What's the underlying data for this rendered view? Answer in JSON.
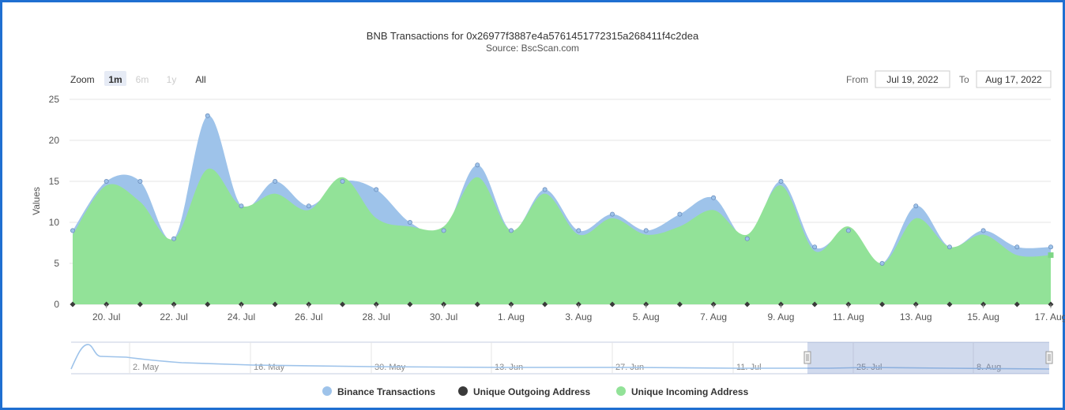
{
  "chart_data": {
    "type": "area",
    "title": "BNB Transactions for 0x26977f3887e4a5761451772315a268411f4c2dea",
    "subtitle": "Source: BscScan.com",
    "ylabel": "Values",
    "ylim": [
      0,
      25
    ],
    "yticks": [
      "0",
      "5",
      "10",
      "15",
      "20",
      "25"
    ],
    "grid": true,
    "legend_position": "bottom",
    "x": [
      "2022-07-19",
      "2022-07-20",
      "2022-07-21",
      "2022-07-22",
      "2022-07-23",
      "2022-07-24",
      "2022-07-25",
      "2022-07-26",
      "2022-07-27",
      "2022-07-28",
      "2022-07-29",
      "2022-07-30",
      "2022-07-31",
      "2022-08-01",
      "2022-08-02",
      "2022-08-03",
      "2022-08-04",
      "2022-08-05",
      "2022-08-06",
      "2022-08-07",
      "2022-08-08",
      "2022-08-09",
      "2022-08-10",
      "2022-08-11",
      "2022-08-12",
      "2022-08-13",
      "2022-08-14",
      "2022-08-15",
      "2022-08-16",
      "2022-08-17"
    ],
    "xticks": [
      "20. Jul",
      "22. Jul",
      "24. Jul",
      "26. Jul",
      "28. Jul",
      "30. Jul",
      "1. Aug",
      "3. Aug",
      "5. Aug",
      "7. Aug",
      "9. Aug",
      "11. Aug",
      "13. Aug",
      "15. Aug",
      "17. Aug"
    ],
    "series": [
      {
        "name": "Binance Transactions",
        "color": "#9ec3ea",
        "values": [
          9,
          15,
          15,
          8,
          23,
          12,
          15,
          12,
          15,
          14,
          10,
          9,
          17,
          9,
          14,
          9,
          11,
          9,
          11,
          13,
          8,
          15,
          7,
          9,
          5,
          12,
          7,
          9,
          7,
          7
        ]
      },
      {
        "name": "Unique Outgoing Address",
        "color": "#3a3a3a",
        "values": [
          0,
          0,
          0,
          0,
          0,
          0,
          0,
          0,
          0,
          0,
          0,
          0,
          0,
          0,
          0,
          0,
          0,
          0,
          0,
          0,
          0,
          0,
          0,
          0,
          0,
          0,
          0,
          0,
          0,
          0
        ]
      },
      {
        "name": "Unique Incoming Address",
        "color": "#92e298",
        "values": [
          8.5,
          14.5,
          12.5,
          8,
          16.5,
          12,
          13.5,
          11.5,
          15.5,
          10.5,
          9.5,
          9.5,
          15.5,
          9,
          13.5,
          8.5,
          10.5,
          8.5,
          9.5,
          11.5,
          8.5,
          14.5,
          6.5,
          9.5,
          5,
          10.5,
          7,
          8.5,
          6,
          6
        ]
      }
    ]
  },
  "range_selector": {
    "zoom_label": "Zoom",
    "buttons": [
      {
        "label": "1m",
        "state": "active"
      },
      {
        "label": "6m",
        "state": "disabled"
      },
      {
        "label": "1y",
        "state": "disabled"
      },
      {
        "label": "All",
        "state": "normal"
      }
    ],
    "from_label": "From",
    "from_value": "Jul 19, 2022",
    "to_label": "To",
    "to_value": "Aug 17, 2022"
  },
  "navigator": {
    "ticks": [
      "2. May",
      "16. May",
      "30. May",
      "13. Jun",
      "27. Jun",
      "11. Jul",
      "25. Jul",
      "8. Aug"
    ]
  },
  "colors": {
    "frame": "#1f6fd1",
    "grid": "#e6e6e6",
    "navigator_mask": "#6685c2"
  }
}
